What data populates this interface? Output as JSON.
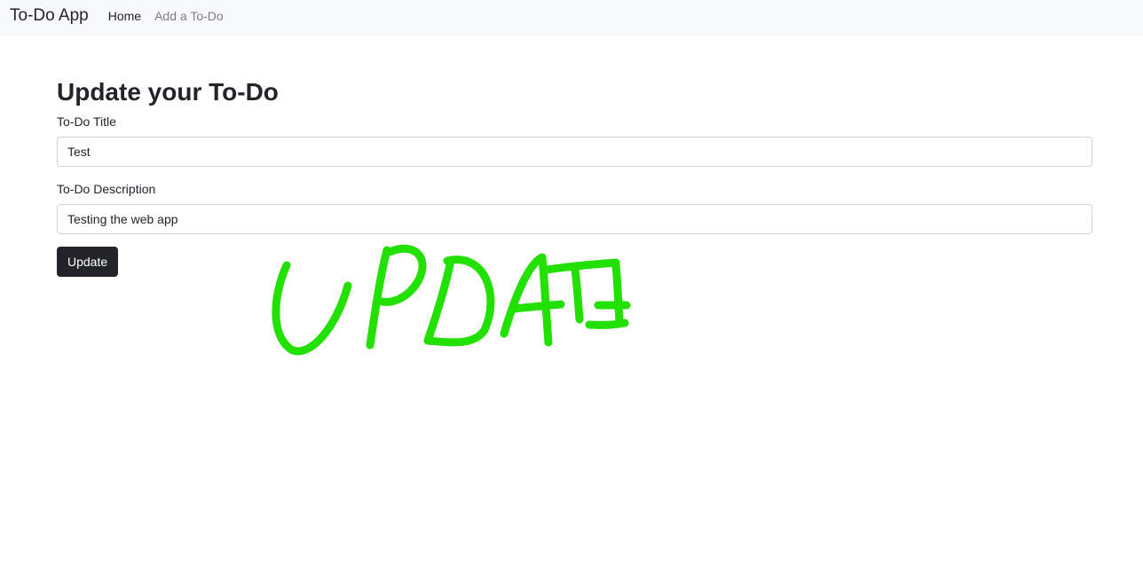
{
  "navbar": {
    "brand": "To-Do App",
    "links": [
      {
        "label": "Home",
        "active": true
      },
      {
        "label": "Add a To-Do",
        "active": false
      }
    ]
  },
  "form": {
    "heading": "Update your To-Do",
    "title_label": "To-Do Title",
    "title_value": "Test",
    "description_label": "To-Do Description",
    "description_value": "Testing the web app",
    "submit_label": "Update"
  },
  "annotation": {
    "handwritten_text": "UPDATE",
    "color": "#22e000"
  },
  "colors": {
    "navbar_bg": "#f8f9fa",
    "button_bg": "#212529",
    "text": "#212529",
    "muted_link": "#7b7f84"
  }
}
